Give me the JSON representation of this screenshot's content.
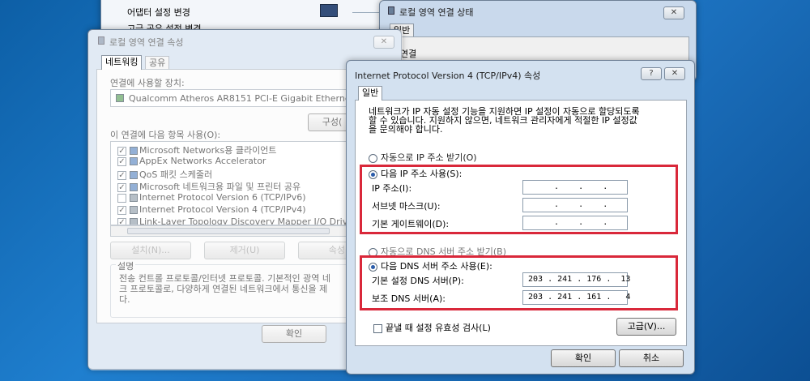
{
  "desktop": {
    "sidebar_items": [
      "어댑터 설정 변경",
      "고급 공유 설정 변경"
    ]
  },
  "status_window": {
    "title": "로컬 영역 연결 상태",
    "tab": "일반",
    "section": "연결"
  },
  "props_window": {
    "title": "로컬 영역 연결 속성",
    "tabs": [
      "네트워킹",
      "공유"
    ],
    "connect_using_label": "연결에 사용할 장치:",
    "adapter_name": "Qualcomm Atheros AR8151 PCI-E Gigabit Ethernet",
    "configure_button": "구성(",
    "items_label": "이 연결에 다음 항목 사용(O):",
    "items": [
      {
        "checked": true,
        "label": "Microsoft Networks용 클라이언트"
      },
      {
        "checked": true,
        "label": "AppEx Networks Accelerator"
      },
      {
        "checked": true,
        "label": "QoS 패킷 스케줄러"
      },
      {
        "checked": true,
        "label": "Microsoft 네트워크용 파일 및 프린터 공유"
      },
      {
        "checked": false,
        "label": "Internet Protocol Version 6 (TCP/IPv6)"
      },
      {
        "checked": true,
        "label": "Internet Protocol Version 4 (TCP/IPv4)"
      },
      {
        "checked": false,
        "label": "Link-Layer Topology Discovery Mapper I/O Driver"
      }
    ],
    "install_button": "설치(N)...",
    "remove_button": "제거(U)",
    "properties_button": "속성(",
    "description_label": "설명",
    "description_text": "전송 컨트롤 프로토콜/인터넷 프로토콜. 기본적인 광역 네\n크 프로토콜로, 다양하게 연결된 네트워크에서 통신을 제\n다.",
    "ok_button": "확인"
  },
  "ipv4_dialog": {
    "title": "Internet Protocol Version 4 (TCP/IPv4) 속성",
    "help_glyph": "?",
    "tab": "일반",
    "intro_text": "네트워크가 IP 자동 설정 기능을 지원하면 IP 설정이 자동으로 할당되도록\n할 수 있습니다. 지원하지 않으면, 네트워크 관리자에게 적절한 IP 설정값\n을 문의해야 합니다.",
    "auto_ip_label": "자동으로 IP 주소 받기(O)",
    "manual_ip_label": "다음 IP 주소 사용(S):",
    "ip_address_label": "IP 주소(I):",
    "ip_address_value": ".    .    .",
    "subnet_label": "서브넷 마스크(U):",
    "subnet_value": ".    .    .",
    "gateway_label": "기본 게이트웨이(D):",
    "gateway_value": ".    .    .",
    "auto_dns_label": "자동으로 DNS 서버 주소 받기(B)",
    "manual_dns_label": "다음 DNS 서버 주소 사용(E):",
    "preferred_dns_label": "기본 설정 DNS 서버(P):",
    "preferred_dns_value": "203 . 241 . 176 .  13",
    "alternate_dns_label": "보조 DNS 서버(A):",
    "alternate_dns_value": "203 . 241 . 161 .   4",
    "validate_label": "끝낼 때 설정 유효성 검사(L)",
    "advanced_button": "고급(V)...",
    "ok_button": "확인",
    "cancel_button": "취소"
  },
  "colors": {
    "highlight": "#d9283a",
    "desktop": "#1f7fcf"
  }
}
